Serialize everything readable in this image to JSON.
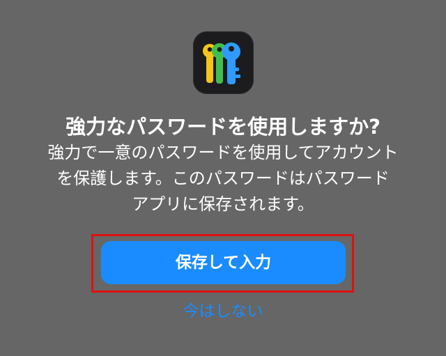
{
  "dialog": {
    "app_icon": "passwords-keys-icon",
    "title": "強力なパスワードを使用しますか?",
    "message_lines": [
      "強力で一意のパスワードを使用してアカウント",
      "を保護します。このパスワードはパスワード",
      "アプリに保存されます。"
    ],
    "primary_button": "保存して入力",
    "secondary_button": "今はしない"
  },
  "colors": {
    "background": "#666666",
    "accent": "#1a8cff",
    "highlight": "#e01010",
    "icon_background": "#1c1c1e",
    "key_yellow": "#f5c518",
    "key_green": "#3fbf4f",
    "key_blue": "#2e9bff"
  }
}
